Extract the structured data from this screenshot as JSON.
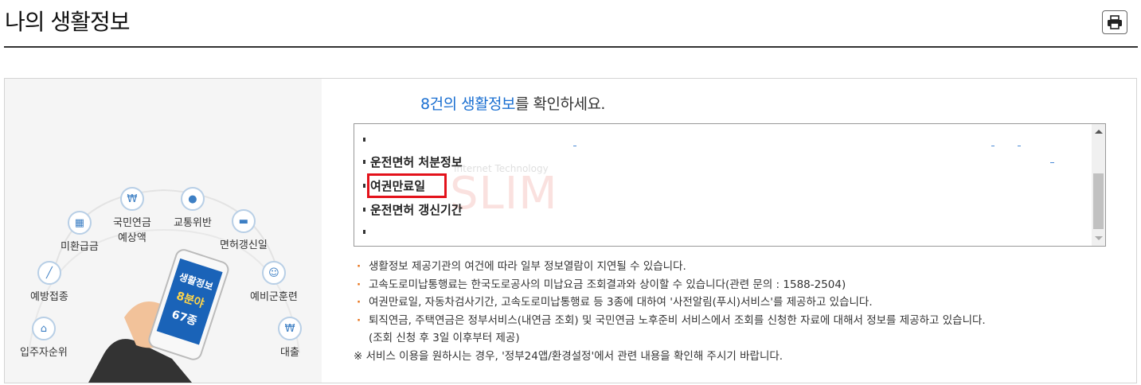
{
  "page": {
    "title": "나의 생활정보",
    "print_icon": "printer-icon"
  },
  "headline": {
    "count_text": "8건의 생활정보",
    "suffix": "를 확인하세요."
  },
  "illustration": {
    "phone_lines": [
      "생활정보",
      "8분야",
      "67종"
    ],
    "services": [
      {
        "label": "미환급금",
        "icon": "calculator-icon"
      },
      {
        "label": "국민연금\n예상액",
        "icon": "monitor-won-icon"
      },
      {
        "label": "교통위반",
        "icon": "traffic-light-icon"
      },
      {
        "label": "면허갱신일",
        "icon": "car-icon"
      },
      {
        "label": "예방접종",
        "icon": "syringe-icon"
      },
      {
        "label": "예비군훈련",
        "icon": "soldier-icon"
      },
      {
        "label": "입주자순위",
        "icon": "house-icon"
      },
      {
        "label": "대출",
        "icon": "money-bag-icon"
      }
    ]
  },
  "info_list": {
    "items": [
      "운전면허 처분정보",
      "여권만료일",
      "운전면허 갱신기간"
    ],
    "watermark": "SLIM",
    "watermark_sub": "Internet Technology",
    "highlighted_index": 1
  },
  "notes": [
    "생활정보 제공기관의 여건에 따라 일부 정보열람이 지연될 수 있습니다.",
    "고속도로미납통행료는 한국도로공사의 미납요금 조회결과와 상이할 수 있습니다(관련 문의 : 1588-2504)",
    "여권만료일, 자동차검사기간, 고속도로미납통행료 등 3종에 대하여 '사전알림(푸시)서비스'를 제공하고 있습니다.",
    "퇴직연금, 주택연금은 정부서비스(내연금 조회) 및 국민연금 노후준비 서비스에서 조회를 신청한 자료에 대해서 정보를 제공하고 있습니다.",
    "(조회 신청 후 3일 이후부터 제공)"
  ],
  "footer_note": "※ 서비스 이용을 원하시는 경우, '정부24앱/환경설정'에서 관련 내용을 확인해 주시기 바랍니다.",
  "colors": {
    "accent": "#1a6fd1",
    "highlight": "#e3121b",
    "bullet": "#e8731a"
  }
}
